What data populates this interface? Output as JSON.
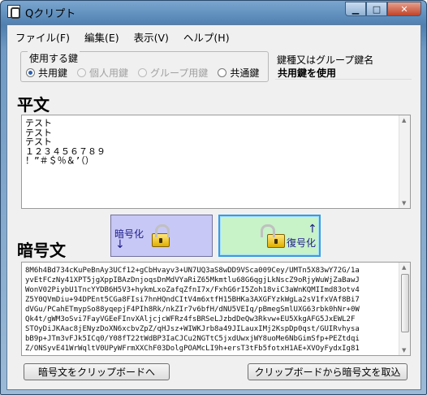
{
  "window": {
    "title": "Qクリプト"
  },
  "menu": [
    "ファイル(F)",
    "編集(E)",
    "表示(V)",
    "ヘルプ(H)"
  ],
  "key_group": {
    "label": "使用する鍵",
    "options": [
      {
        "label": "共用鍵",
        "selected": true,
        "enabled": true
      },
      {
        "label": "個人用鍵",
        "selected": false,
        "enabled": false
      },
      {
        "label": "グループ用鍵",
        "selected": false,
        "enabled": false
      },
      {
        "label": "共通鍵",
        "selected": false,
        "enabled": true
      }
    ]
  },
  "key_kind": {
    "label": "鍵種又はグループ鍵名",
    "value": "共用鍵を使用"
  },
  "plaintext": {
    "heading": "平文",
    "lines": [
      "テスト",
      "テスト",
      "テスト",
      "１２３４５６７８９",
      "！”＃＄％＆’（）"
    ]
  },
  "buttons": {
    "encrypt": "暗号化",
    "decrypt": "復号化"
  },
  "ciphertext": {
    "heading": "暗号文",
    "lines": [
      "8M6h4Bd734cKuPeBnAy3UCf12+gCbHvayv3+UN7UQ3aS8wDD9VSca009Cey/UMTn5X83wY72G/1a",
      "yvEtFCzNy41XPT5jgXppIBAzDnjoqsDnMdVYaRiZ65Mkmtlu68G6qgjLkNscZ9oRjyWuWjZaBawJ",
      "WonV02PiybU1TncYYDB6H5V3+hykmLxoZafqZfnI7x/FxhG6rI5Zoh18viC3aWnKQMIImd83otv4",
      "Z5Y0QVmDiu+94DPEnt5CGa8FIsi7hnHQndCItV4m6xtfH15BHKa3AXGFYzkWgLa2sV1fxVAf8Bi7",
      "dVGu/PCahETmypSo88yqepjF4PIh8Rk/nkZIr7v6bfH/dNU5VEIq/pBmegSmlUXG63rbk0hNr+0W",
      "Qk4t/gWM3oSvi7FayVGEeFInvXAljcjcWFRz4fsBRSeLJzbdDeQw3Rkvw+EU5XkgAFG5JxEWL2F",
      "STOyDiJKAac8jENyzDoXN6xcbvZpZ/qHJsz+WIWKJrb8a49JILauxIMj2KspDp0qst/GUIRvhysa",
      "bB9p+JTm3vFJk5ICq0/Y08fT22tWdBP3IaCJCu2NGTtC5jxdUwxjWY8uoMe6NbGimSfp+PEZtdqi",
      "Z/ONSyvE41WrWqltV0UPyWFrmXXChF03DolgPOAMcLI9h+ersT3tFb5fotxH1AE+XVOyFydxIg81"
    ]
  },
  "actions": {
    "copy": "暗号文をクリップボードへ",
    "paste": "クリップボードから暗号文を取込"
  }
}
